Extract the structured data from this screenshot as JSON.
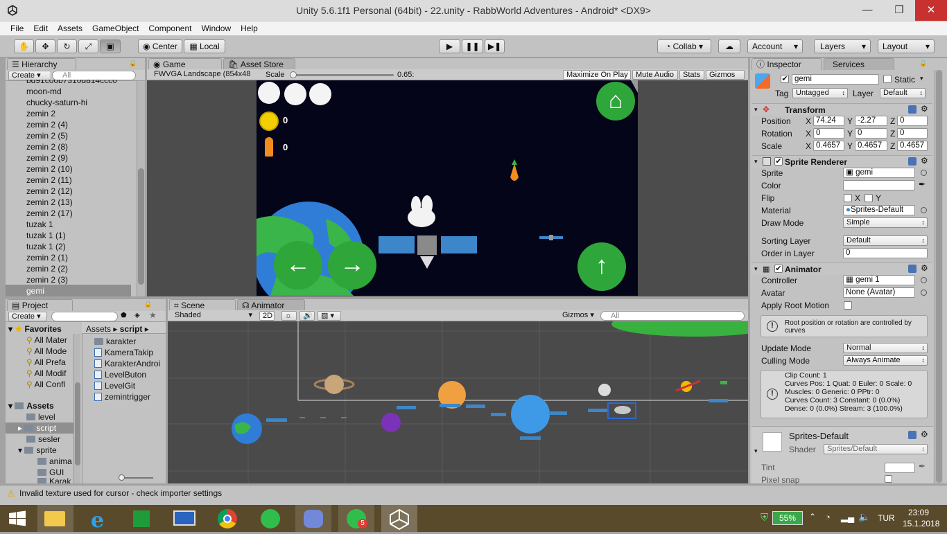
{
  "window": {
    "title": "Unity 5.6.1f1 Personal (64bit) - 22.unity - RabbWorld Adventures - Android* <DX9>"
  },
  "menu": [
    "File",
    "Edit",
    "Assets",
    "GameObject",
    "Component",
    "Window",
    "Help"
  ],
  "toolbar": {
    "pivot_label": "Center",
    "space_label": "Local",
    "collab_label": "Collab",
    "account_label": "Account",
    "layers_label": "Layers",
    "layout_label": "Layout"
  },
  "hierarchy": {
    "tab": "Hierarchy",
    "create": "Create",
    "search_placeholder": "All",
    "items": [
      "bd91c00b7310d814ccc0",
      "moon-md",
      "chucky-saturn-hi",
      "zemin 2",
      "zemin 2 (4)",
      "zemin 2 (5)",
      "zemin 2 (8)",
      "zemin 2 (9)",
      "zemin 2 (10)",
      "zemin 2 (11)",
      "zemin 2 (12)",
      "zemin 2 (13)",
      "zemin 2 (17)",
      "tuzak 1",
      "tuzak 1 (1)",
      "tuzak 1 (2)",
      "zemin 2 (1)",
      "zemin 2 (2)",
      "zemin 2 (3)",
      "gemi"
    ],
    "selected": "gemi"
  },
  "game": {
    "tab": "Game",
    "asset_store_tab": "Asset Store",
    "resolution": "FWVGA Landscape (854x48",
    "scale_label": "Scale",
    "scale_value": "0.65:",
    "maximize": "Maximize On Play",
    "mute": "Mute Audio",
    "stats": "Stats",
    "gizmos": "Gizmos",
    "coin_count": "0",
    "carrot_count": "0"
  },
  "scene": {
    "tab": "Scene",
    "animator_tab": "Animator",
    "shading": "Shaded",
    "mode_2d": "2D",
    "gizmos": "Gizmos",
    "search_placeholder": "All"
  },
  "project": {
    "tab": "Project",
    "create": "Create",
    "favorites_label": "Favorites",
    "favorites": [
      "All Mater",
      "All Mode",
      "All Prefa",
      "All Modif",
      "All Confl"
    ],
    "assets_label": "Assets",
    "asset_folders": [
      "level",
      "script",
      "sesler",
      "sprite",
      "anima",
      "GUI",
      "Karak"
    ],
    "breadcrumb_root": "Assets",
    "breadcrumb_current": "script",
    "files": [
      {
        "name": "karakter",
        "kind": "folder"
      },
      {
        "name": "KameraTakip",
        "kind": "script"
      },
      {
        "name": "KarakterAndroi",
        "kind": "script"
      },
      {
        "name": "LevelButon",
        "kind": "script"
      },
      {
        "name": "LevelGit",
        "kind": "script"
      },
      {
        "name": "zemintrigger",
        "kind": "script"
      }
    ]
  },
  "inspector": {
    "tab": "Inspector",
    "services_tab": "Services",
    "object_name": "gemi",
    "static_label": "Static",
    "tag_label": "Tag",
    "tag_value": "Untagged",
    "layer_label": "Layer",
    "layer_value": "Default",
    "transform": {
      "title": "Transform",
      "position_label": "Position",
      "rotation_label": "Rotation",
      "scale_label": "Scale",
      "position": [
        "74.24",
        "-2.27",
        "0"
      ],
      "rotation": [
        "0",
        "0",
        "0"
      ],
      "scale": [
        "0.4657",
        "0.4657",
        "0.4657"
      ],
      "axes": [
        "X",
        "Y",
        "Z"
      ]
    },
    "sprite_renderer": {
      "title": "Sprite Renderer",
      "sprite_label": "Sprite",
      "sprite_value": "gemi",
      "color_label": "Color",
      "flip_label": "Flip",
      "flip_x": "X",
      "flip_y": "Y",
      "material_label": "Material",
      "material_value": "Sprites-Default",
      "draw_mode_label": "Draw Mode",
      "draw_mode_value": "Simple",
      "sorting_layer_label": "Sorting Layer",
      "sorting_layer_value": "Default",
      "order_label": "Order in Layer",
      "order_value": "0"
    },
    "animator": {
      "title": "Animator",
      "controller_label": "Controller",
      "controller_value": "gemi 1",
      "avatar_label": "Avatar",
      "avatar_value": "None (Avatar)",
      "root_motion_label": "Apply Root Motion",
      "note": "Root position or rotation are controlled by curves",
      "update_mode_label": "Update Mode",
      "update_mode_value": "Normal",
      "culling_mode_label": "Culling Mode",
      "culling_mode_value": "Always Animate",
      "info": [
        "Clip Count: 1",
        "Curves Pos: 1 Quat: 0 Euler: 0 Scale: 0",
        "Muscles: 0 Generic: 0 PPtr: 0",
        "Curves Count: 3 Constant: 0 (0.0%)",
        "Dense: 0 (0.0%) Stream: 3 (100.0%)"
      ]
    },
    "material": {
      "name": "Sprites-Default",
      "shader_label": "Shader",
      "shader_value": "Sprites/Default",
      "tint_label": "Tint",
      "pixel_snap_label": "Pixel snap"
    }
  },
  "status_message": "Invalid texture used for cursor - check importer settings",
  "taskbar": {
    "battery": "55%",
    "language": "TUR",
    "time": "23:09",
    "date": "15.1.2018",
    "whatsapp_badge": "5"
  },
  "colors": {
    "game_background": "#05051a",
    "green_button": "#2ea63a",
    "selection": "#8fa4c4",
    "scene_background": "#4a4a4a"
  }
}
